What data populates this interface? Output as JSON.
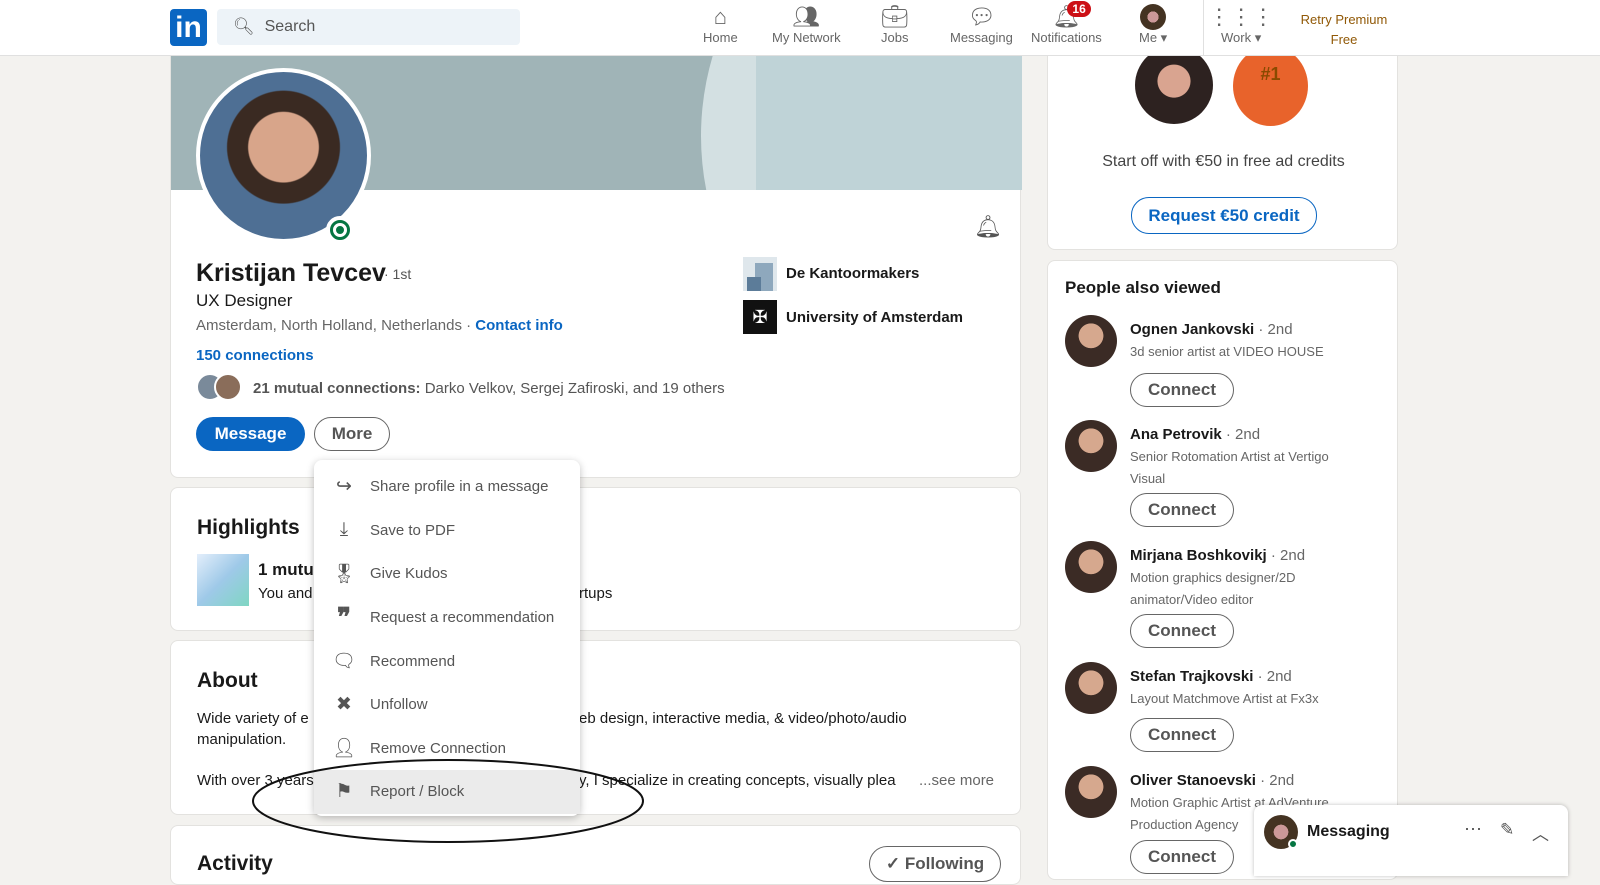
{
  "header": {
    "logo": "in",
    "search_placeholder": "Search",
    "nav": [
      {
        "label": "Home",
        "icon": "home-icon"
      },
      {
        "label": "My Network",
        "icon": "network-icon"
      },
      {
        "label": "Jobs",
        "icon": "briefcase-icon"
      },
      {
        "label": "Messaging",
        "icon": "chat-icon"
      },
      {
        "label": "Notifications",
        "icon": "bell-icon",
        "badge": "16"
      },
      {
        "label": "Me",
        "icon": "avatar"
      },
      {
        "label": "Work",
        "icon": "grid-icon"
      }
    ],
    "premium_line1": "Retry Premium",
    "premium_line2": "Free"
  },
  "profile": {
    "name": "Kristijan Tevcev",
    "degree": "· 1st",
    "headline": "UX Designer",
    "location": "Amsterdam, North Holland, Netherlands ·",
    "contact": "Contact info",
    "connections": "150 connections",
    "mutual_bold": "21 mutual connections:",
    "mutual_rest": "Darko Velkov, Sergej Zafiroski, and 19 others",
    "company": "De Kantoormakers",
    "school": "University of Amsterdam",
    "message_btn": "Message",
    "more_btn": "More"
  },
  "menu": [
    {
      "label": "Share profile in a message",
      "icon": "share-arrow-icon"
    },
    {
      "label": "Save to PDF",
      "icon": "download-icon"
    },
    {
      "label": "Give Kudos",
      "icon": "award-icon"
    },
    {
      "label": "Request a recommendation",
      "icon": "quote-icon"
    },
    {
      "label": "Recommend",
      "icon": "comment-icon"
    },
    {
      "label": "Unfollow",
      "icon": "x-circle-icon"
    },
    {
      "label": "Remove Connection",
      "icon": "remove-person-icon"
    },
    {
      "label": "Report / Block",
      "icon": "flag-icon"
    }
  ],
  "highlights": {
    "title": "Highlights",
    "line1": "1 mutu",
    "line2": "You and",
    "line2_tail": "rtups"
  },
  "about": {
    "title": "About",
    "p1a": "Wide variety of e",
    "p1b": "eb design, interactive media, & video/photo/audio",
    "p1c": "manipulation.",
    "p2a": "With over 3 years",
    "p2b": "y, I specialize in creating concepts, visually plea",
    "see_more": "...see more"
  },
  "activity": {
    "title": "Activity",
    "follow_btn": "✓ Following"
  },
  "ad": {
    "text": "Start off with €50 in free ad credits",
    "button": "Request €50 credit",
    "trophy": "#1"
  },
  "people": {
    "title": "People also viewed",
    "connect": "Connect",
    "items": [
      {
        "name": "Ognen Jankovski",
        "degree": "· 2nd",
        "sub": "3d senior artist at VIDEO HOUSE"
      },
      {
        "name": "Ana Petrovik",
        "degree": "· 2nd",
        "sub": "Senior Rotomation Artist at Vertigo Visual"
      },
      {
        "name": "Mirjana Boshkovikj",
        "degree": "· 2nd",
        "sub": "Motion graphics designer/2D animator/Video editor"
      },
      {
        "name": "Stefan Trajkovski",
        "degree": "· 2nd",
        "sub": "Layout Matchmove Artist at Fx3x"
      },
      {
        "name": "Oliver Stanoevski",
        "degree": "· 2nd",
        "sub": "Motion Graphic Artist at AdVenture Production Agency"
      }
    ]
  },
  "messaging": {
    "label": "Messaging"
  },
  "colors": {
    "brand": "#0a66c2",
    "premium": "#915907",
    "badge": "#cc1016",
    "online": "#057642"
  }
}
